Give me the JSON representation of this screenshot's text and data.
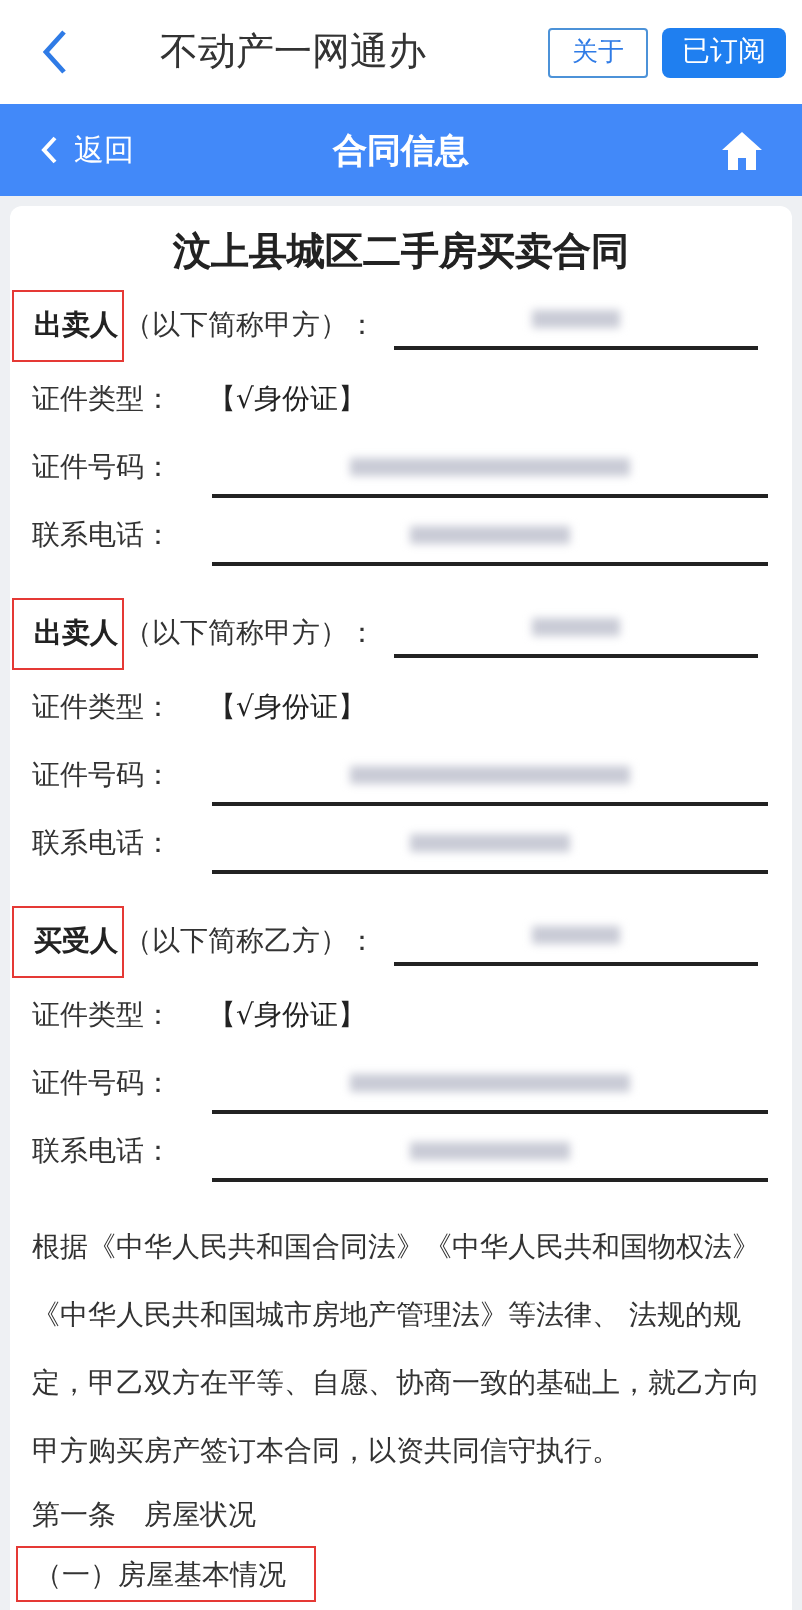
{
  "app_bar": {
    "title": "不动产一网通办",
    "about_button": "关于",
    "subscribed_button": "已订阅"
  },
  "nav_bar": {
    "back": "返回",
    "title": "合同信息"
  },
  "contract": {
    "title": "汶上县城区二手房买卖合同",
    "parties": [
      {
        "role": "出卖人",
        "note": "（以下简称甲方）：",
        "highlighted": true,
        "id_type_label": "证件类型：",
        "id_type_value": "【√身份证】",
        "id_no_label": "证件号码：",
        "phone_label": "联系电话："
      },
      {
        "role": "出卖人",
        "note": "（以下简称甲方）：",
        "highlighted": true,
        "id_type_label": "证件类型：",
        "id_type_value": "【√身份证】",
        "id_no_label": "证件号码：",
        "phone_label": "联系电话："
      },
      {
        "role": "买受人",
        "note": "（以下简称乙方）：",
        "highlighted": true,
        "id_type_label": "证件类型：",
        "id_type_value": "【√身份证】",
        "id_no_label": "证件号码：",
        "phone_label": "联系电话："
      }
    ],
    "preamble": "根据《中华人民共和国合同法》《中华人民共和国物权法》《中华人民共和国城市房地产管理法》等法律、 法规的规定，甲乙双方在平等、自愿、协商一致的基础上，就乙方向甲方购买房产签订本合同，以资共同信守执行。",
    "article": "第一条　房屋状况",
    "subsection": {
      "text": "（一）房屋基本情况",
      "highlighted": true
    }
  }
}
